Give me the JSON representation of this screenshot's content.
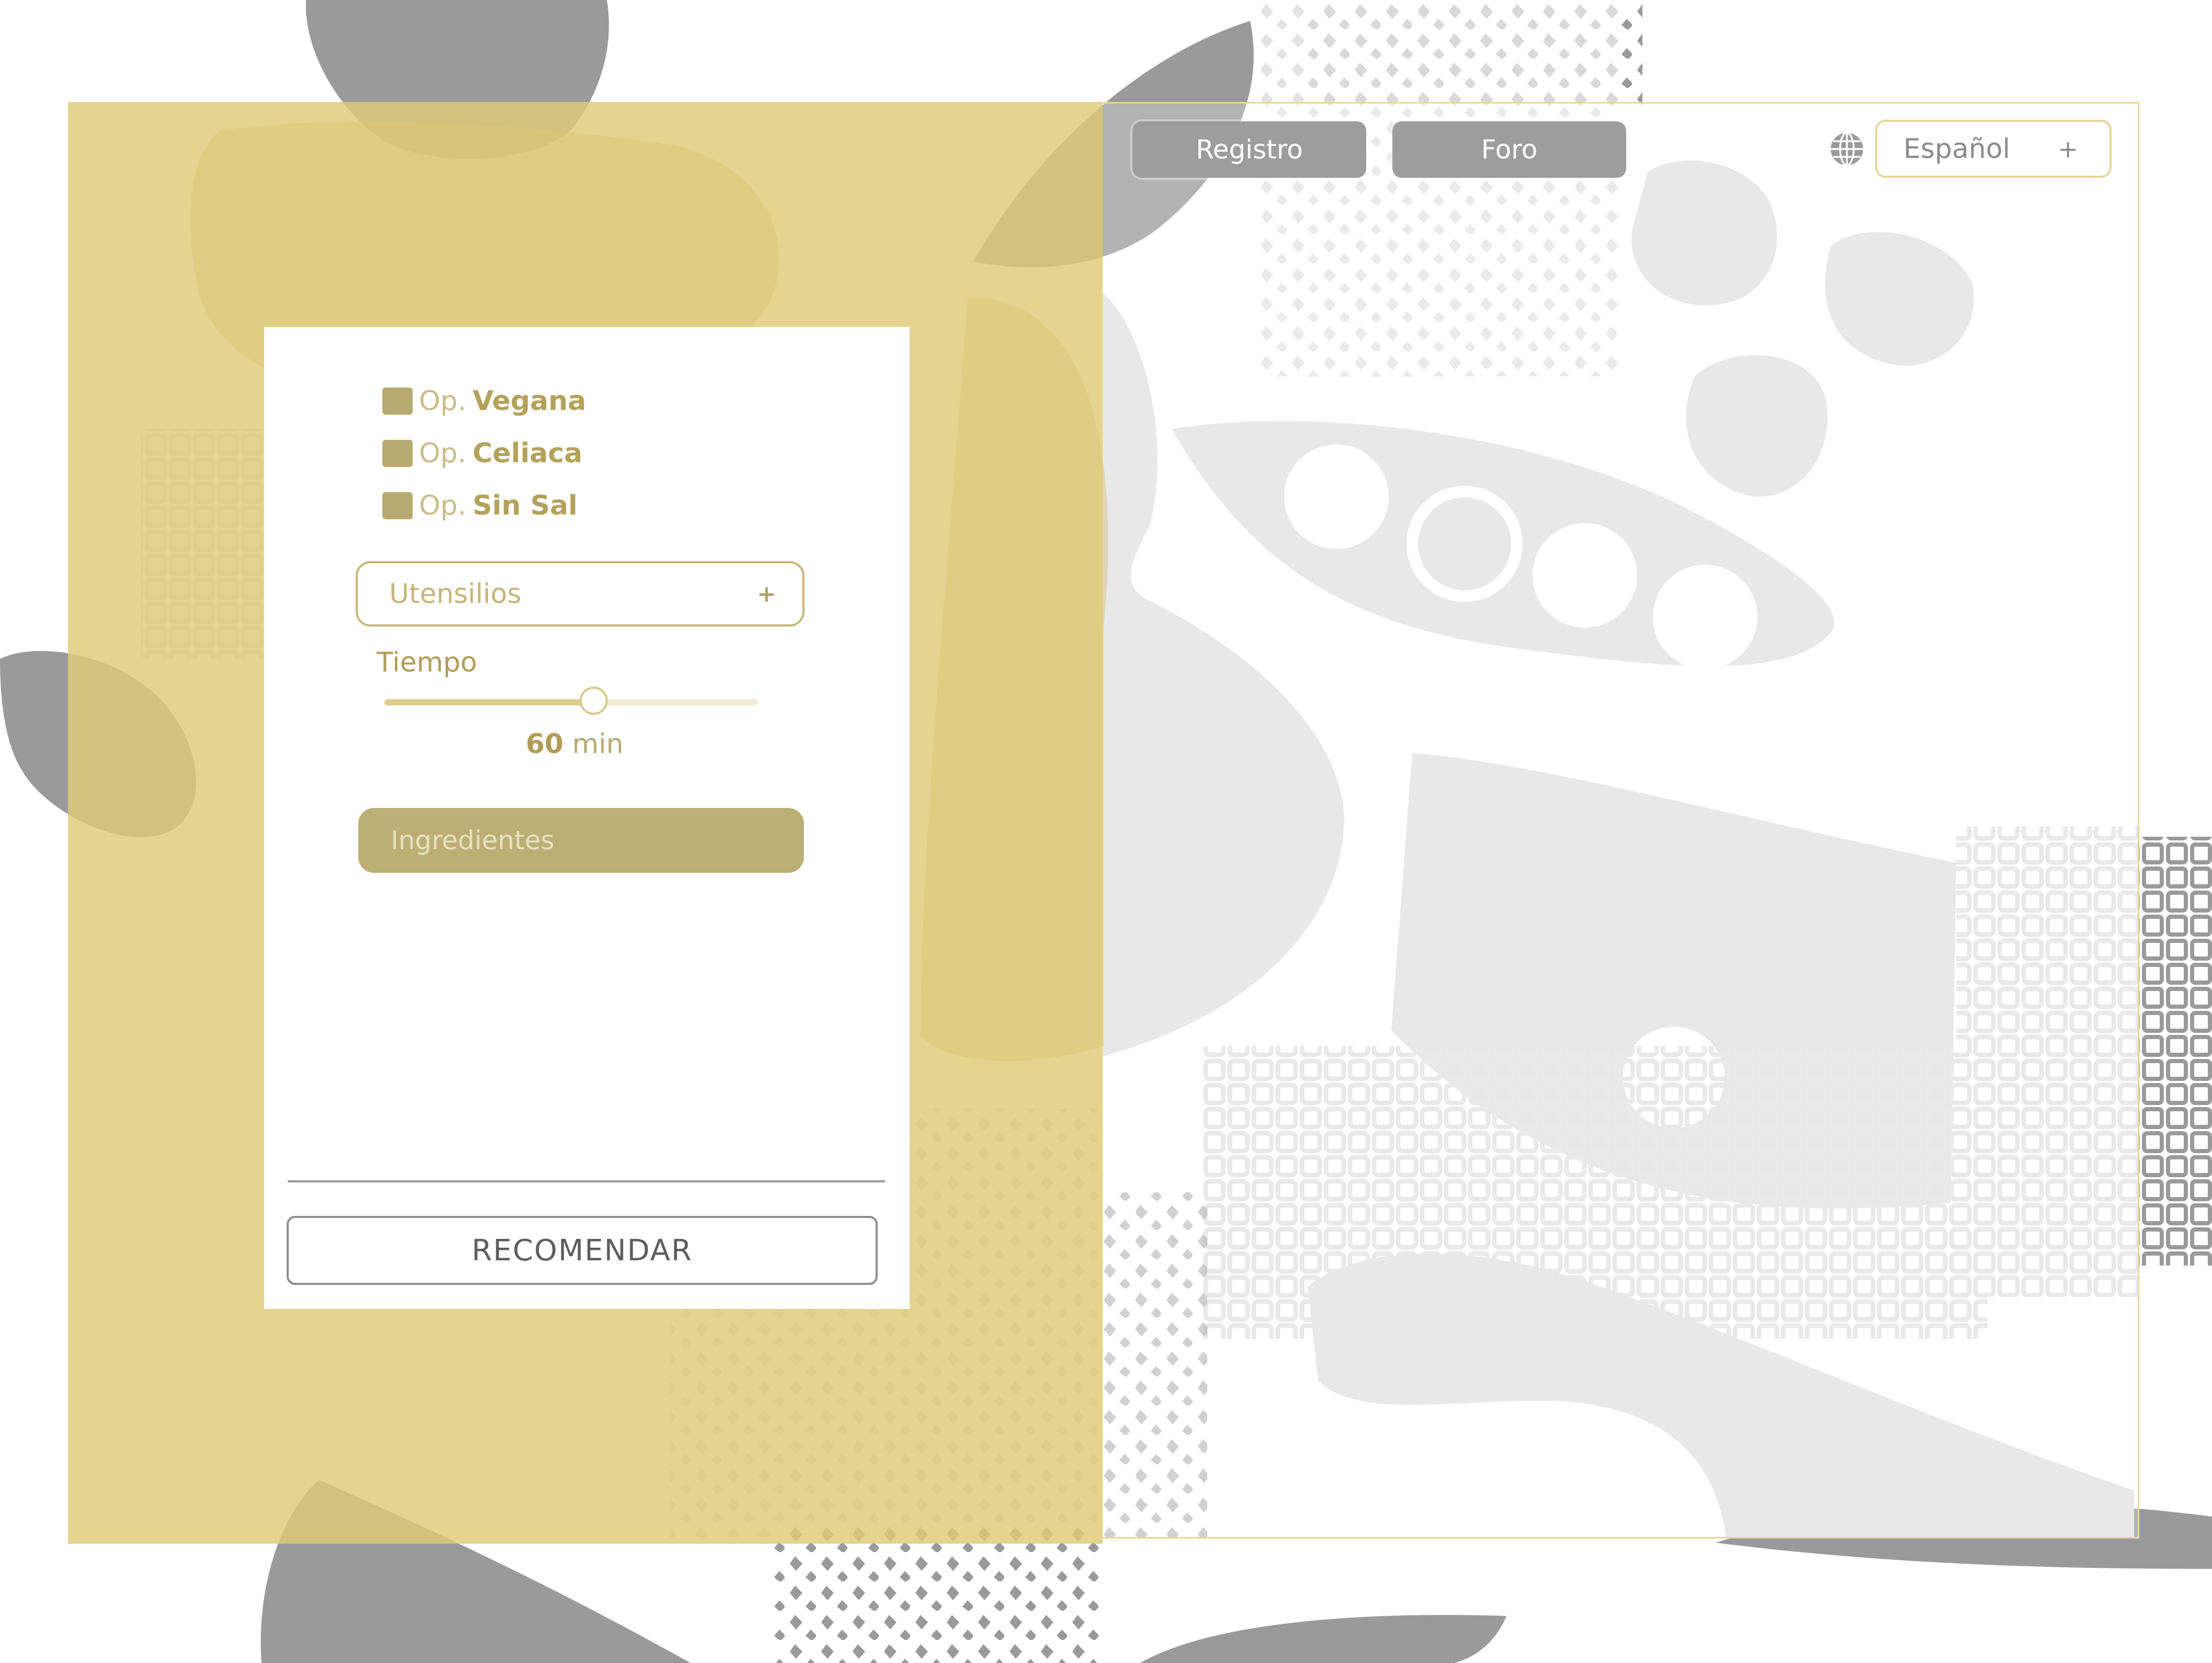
{
  "nav": {
    "registro_label": "Registro",
    "foro_label": "Foro"
  },
  "language": {
    "current": "Español",
    "expand_symbol": "+",
    "icon": "globe-icon"
  },
  "filters": {
    "options": [
      {
        "prefix": "Op.",
        "name": "Vegana"
      },
      {
        "prefix": "Op.",
        "name": "Celiaca"
      },
      {
        "prefix": "Op.",
        "name": "Sin Sal"
      }
    ],
    "utensilios_label": "Utensilios",
    "utensilios_symbol": "+",
    "tiempo_label": "Tiempo",
    "tiempo_value": "60",
    "tiempo_unit": "min",
    "tiempo_fraction": 0.56,
    "ingredientes_placeholder": "Ingredientes",
    "recomendar_label": "RECOMENDAR"
  },
  "colors": {
    "panel_gold": "#decb78",
    "accent_gold": "#b4a25c",
    "nav_gray": "#9d9d9d",
    "shape_light_gray": "#e0e0e0",
    "shape_dark_gray": "#9a9a9a"
  }
}
